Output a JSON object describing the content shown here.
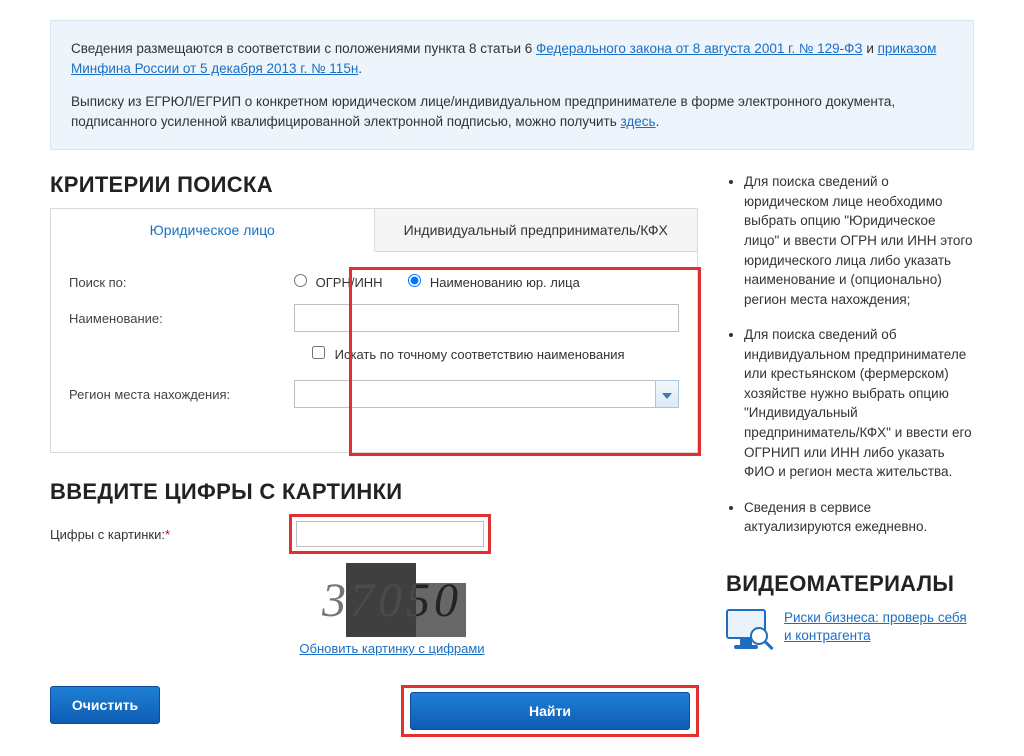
{
  "notice": {
    "p1_a": "Сведения размещаются в соответствии с положениями пункта 8 статьи 6 ",
    "link1": "Федерального закона от 8 августа 2001 г. № 129-ФЗ",
    "p1_b": " и ",
    "link2": "приказом Минфина России от 5 декабря 2013 г. № 115н",
    "p1_c": ".",
    "p2_a": "Выписку из ЕГРЮЛ/ЕГРИП о конкретном юридическом лице/индивидуальном предпринимателе в форме электронного документа, подписанного усиленной квалифицированной электронной подписью, можно получить ",
    "link3": "здесь",
    "p2_b": "."
  },
  "search": {
    "title": "КРИТЕРИИ ПОИСКА",
    "tabs": {
      "legal": "Юридическое лицо",
      "indiv": "Индивидуальный предприниматель/КФХ"
    },
    "labels": {
      "search_by": "Поиск по:",
      "name": "Наименование:",
      "region": "Регион места нахождения:"
    },
    "radios": {
      "ogrn": "ОГРН/ИНН",
      "by_name": "Наименованию юр. лица"
    },
    "exact_match": "Искать по точному соответствию наименования"
  },
  "captcha": {
    "title": "ВВЕДИТЕ ЦИФРЫ С КАРТИНКИ",
    "label": "Цифры с картинки:",
    "asterisk": "*",
    "digits": "37050",
    "refresh": "Обновить картинку с цифрами"
  },
  "buttons": {
    "clear": "Очистить",
    "find": "Найти"
  },
  "sidebar": {
    "tips": [
      "Для поиска сведений о юридическом лице необходимо выбрать опцию \"Юридическое лицо\" и ввести ОГРН или ИНН этого юридического лица либо указать наименование и (опционально) регион места нахождения;",
      "Для поиска сведений об индивидуальном предпринимателе или крестьянском (фермерском) хозяйстве нужно выбрать опцию \"Индивидуальный предприниматель/КФХ\" и ввести его ОГРНИП или ИНН либо указать ФИО и регион места жительства.",
      "Сведения в сервисе актуализируются ежедневно."
    ],
    "video_title": "ВИДЕОМАТЕРИАЛЫ",
    "video_link": "Риски бизнеса: проверь себя и контрагента"
  }
}
